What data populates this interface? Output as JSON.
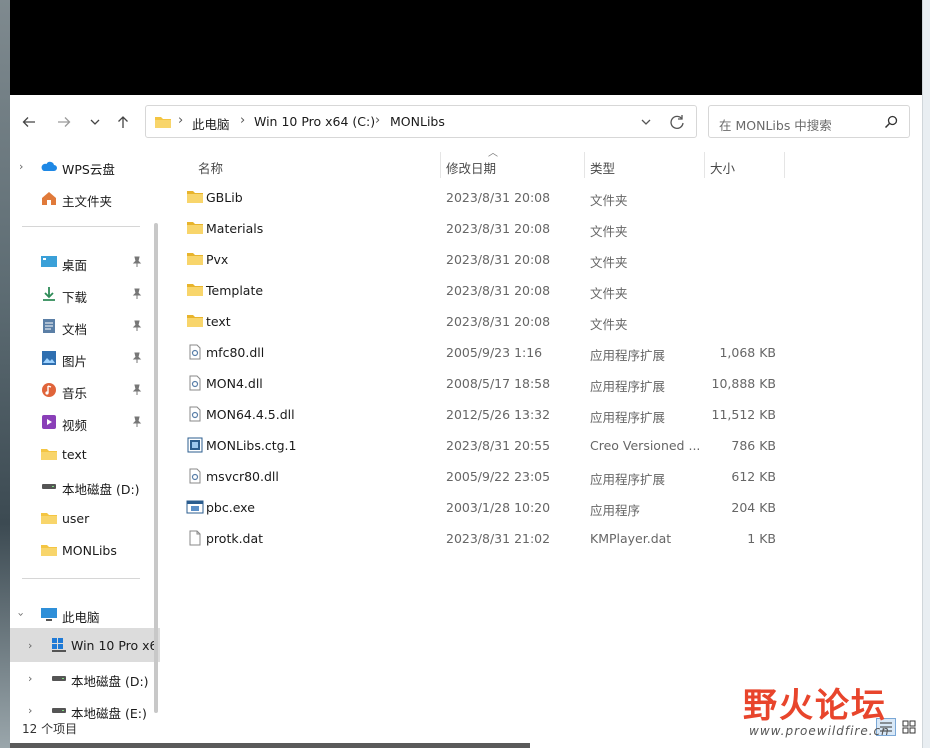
{
  "nav": {
    "back_icon": "arrow-left-icon",
    "forward_icon": "arrow-right-icon",
    "recent_icon": "chevron-down-icon",
    "up_icon": "arrow-up-icon"
  },
  "address": {
    "crumbs": [
      "此电脑",
      "Win 10 Pro x64 (C:)",
      "MONLibs"
    ]
  },
  "search": {
    "placeholder": "在 MONLibs 中搜索"
  },
  "sidebar": {
    "items": [
      {
        "label": "WPS云盘",
        "icon": "cloud-icon"
      },
      {
        "label": "主文件夹",
        "icon": "home-icon"
      },
      {
        "label": "桌面",
        "icon": "desktop-icon",
        "pinned": true
      },
      {
        "label": "下载",
        "icon": "download-icon",
        "pinned": true
      },
      {
        "label": "文档",
        "icon": "document-icon",
        "pinned": true
      },
      {
        "label": "图片",
        "icon": "picture-icon",
        "pinned": true
      },
      {
        "label": "音乐",
        "icon": "music-icon",
        "pinned": true
      },
      {
        "label": "视频",
        "icon": "video-icon",
        "pinned": true
      },
      {
        "label": "text",
        "icon": "folder-icon"
      },
      {
        "label": "本地磁盘 (D:)",
        "icon": "drive-icon"
      },
      {
        "label": "user",
        "icon": "folder-icon"
      },
      {
        "label": "MONLibs",
        "icon": "folder-icon"
      },
      {
        "label": "此电脑",
        "icon": "computer-icon"
      },
      {
        "label": "Win 10 Pro x6",
        "icon": "windows-drive-icon"
      },
      {
        "label": "本地磁盘 (D:)",
        "icon": "drive-icon"
      },
      {
        "label": "本地磁盘 (E:)",
        "icon": "drive-icon"
      }
    ]
  },
  "columns": {
    "name": "名称",
    "date": "修改日期",
    "type": "类型",
    "size": "大小"
  },
  "files": [
    {
      "name": "GBLib",
      "date": "2023/8/31 20:08",
      "type": "文件夹",
      "size": "",
      "icon": "folder"
    },
    {
      "name": "Materials",
      "date": "2023/8/31 20:08",
      "type": "文件夹",
      "size": "",
      "icon": "folder"
    },
    {
      "name": "Pvx",
      "date": "2023/8/31 20:08",
      "type": "文件夹",
      "size": "",
      "icon": "folder"
    },
    {
      "name": "Template",
      "date": "2023/8/31 20:08",
      "type": "文件夹",
      "size": "",
      "icon": "folder"
    },
    {
      "name": "text",
      "date": "2023/8/31 20:08",
      "type": "文件夹",
      "size": "",
      "icon": "folder"
    },
    {
      "name": "mfc80.dll",
      "date": "2005/9/23 1:16",
      "type": "应用程序扩展",
      "size": "1,068 KB",
      "icon": "dll"
    },
    {
      "name": "MON4.dll",
      "date": "2008/5/17 18:58",
      "type": "应用程序扩展",
      "size": "10,888 KB",
      "icon": "dll"
    },
    {
      "name": "MON64.4.5.dll",
      "date": "2012/5/26 13:32",
      "type": "应用程序扩展",
      "size": "11,512 KB",
      "icon": "dll"
    },
    {
      "name": "MONLibs.ctg.1",
      "date": "2023/8/31 20:55",
      "type": "Creo Versioned ...",
      "size": "786 KB",
      "icon": "creo"
    },
    {
      "name": "msvcr80.dll",
      "date": "2005/9/22 23:05",
      "type": "应用程序扩展",
      "size": "612 KB",
      "icon": "dll"
    },
    {
      "name": "pbc.exe",
      "date": "2003/1/28 10:20",
      "type": "应用程序",
      "size": "204 KB",
      "icon": "exe"
    },
    {
      "name": "protk.dat",
      "date": "2023/8/31 21:02",
      "type": "KMPlayer.dat",
      "size": "1 KB",
      "icon": "file"
    }
  ],
  "status": {
    "count": "12 个项目"
  },
  "watermark": {
    "title": "野火论坛",
    "url": "www.proewildfire.cn"
  },
  "colors": {
    "folder": "#f4c542",
    "accent": "#0078d4",
    "watermark": "#e8452c"
  }
}
